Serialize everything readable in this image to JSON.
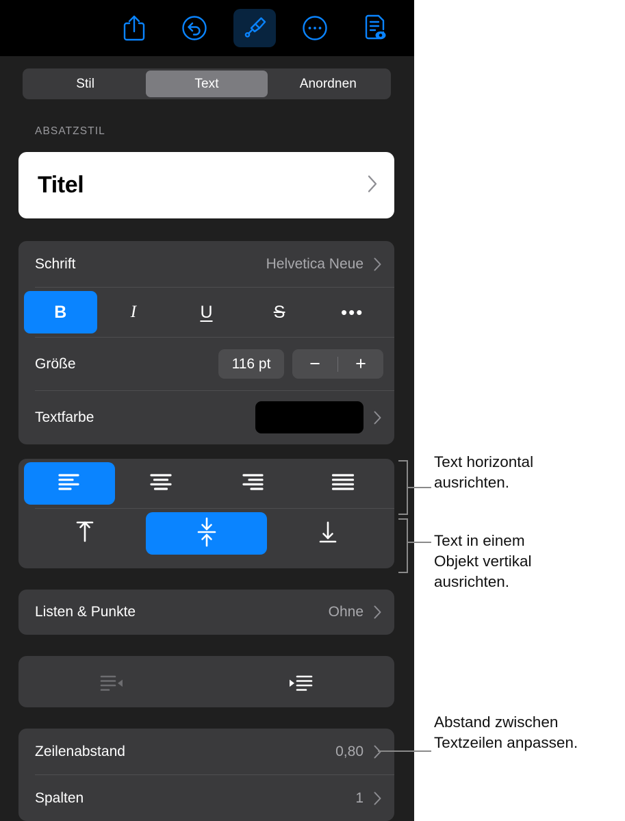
{
  "app": {
    "name": "Pages Format Inspector",
    "platform": "iPadOS"
  },
  "toolbar": {
    "items": [
      {
        "label": "Teilen",
        "icon": "share-icon",
        "active": false
      },
      {
        "label": "Widerrufen",
        "icon": "undo-icon",
        "active": false
      },
      {
        "label": "Format",
        "icon": "paintbrush-icon",
        "active": true
      },
      {
        "label": "Mehr",
        "icon": "ellipsis-circle-icon",
        "active": false
      },
      {
        "label": "Dokument anzeigen",
        "icon": "document-view-icon",
        "active": false
      }
    ]
  },
  "tabs": {
    "items": [
      {
        "label": "Stil",
        "selected": false
      },
      {
        "label": "Text",
        "selected": true
      },
      {
        "label": "Anordnen",
        "selected": false
      }
    ]
  },
  "paragraph_style": {
    "group_label": "ABSATZSTIL",
    "value": "Titel",
    "chevron": "chevron-right-icon"
  },
  "font": {
    "label": "Schrift",
    "value": "Helvetica Neue",
    "styles": [
      {
        "name": "bold",
        "glyph": "B",
        "active": true
      },
      {
        "name": "italic",
        "glyph": "I",
        "active": false
      },
      {
        "name": "underline",
        "glyph": "U",
        "active": false
      },
      {
        "name": "strikethrough",
        "glyph": "S",
        "active": false
      },
      {
        "name": "more",
        "glyph": "•••",
        "active": false
      }
    ],
    "size_label": "Größe",
    "size_value": "116 pt",
    "decrement": "−",
    "increment": "+",
    "color_label": "Textfarbe",
    "color_value": "#000000"
  },
  "alignment": {
    "horizontal": [
      {
        "name": "align-left",
        "active": true
      },
      {
        "name": "align-center",
        "active": false
      },
      {
        "name": "align-right",
        "active": false
      },
      {
        "name": "align-justify",
        "active": false
      }
    ],
    "vertical": [
      {
        "name": "align-top",
        "active": false
      },
      {
        "name": "align-middle",
        "active": true
      },
      {
        "name": "align-bottom",
        "active": false
      }
    ]
  },
  "lists": {
    "label": "Listen & Punkte",
    "value": "Ohne"
  },
  "indent": {
    "decrease": "decrease-indent-icon",
    "increase": "increase-indent-icon"
  },
  "spacing": {
    "line_label": "Zeilenabstand",
    "line_value": "0,80",
    "columns_label": "Spalten",
    "columns_value": "1"
  },
  "callouts": [
    {
      "id": "callout-horizontal",
      "text": "Text horizontal\nausrichten.",
      "line1": "Text horizontal",
      "line2": "ausrichten."
    },
    {
      "id": "callout-vertical",
      "text": "Text in einem\nObjekt vertikal\nausrichten.",
      "line1": "Text in einem",
      "line2": "Objekt vertikal",
      "line3": "ausrichten."
    },
    {
      "id": "callout-linespacing",
      "text": "Abstand zwischen\nTextzeilen anpassen.",
      "line1": "Abstand zwischen",
      "line2": "Textzeilen anpassen."
    }
  ],
  "colors": {
    "accent": "#0a84ff",
    "panel_bg": "#1f1f1f",
    "group_bg": "#3a3a3c",
    "toolbar_bg": "#000000",
    "callout_line": "#8a8a8a"
  }
}
